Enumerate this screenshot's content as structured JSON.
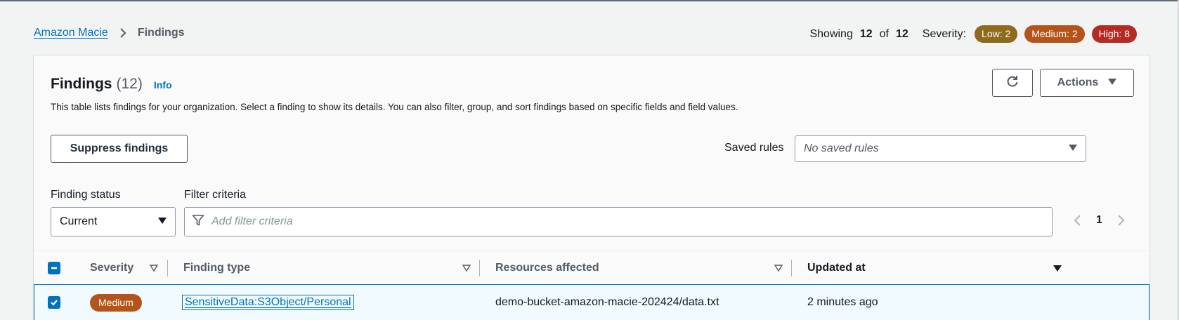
{
  "breadcrumb": {
    "root": "Amazon Macie",
    "current": "Findings"
  },
  "summary": {
    "showing_label": "Showing",
    "showing_count": "12",
    "of_label": "of",
    "total_count": "12",
    "severity_label": "Severity:",
    "low": "Low: 2",
    "medium": "Medium: 2",
    "high": "High: 8"
  },
  "panel": {
    "title": "Findings",
    "count": "(12)",
    "info": "Info",
    "description": "This table lists findings for your organization. Select a finding to show its details. You can also filter, group, and sort findings based on specific fields and field values.",
    "actions_label": "Actions",
    "suppress_label": "Suppress findings",
    "saved_rules_label": "Saved rules",
    "saved_rules_value": "No saved rules",
    "finding_status_label": "Finding status",
    "finding_status_value": "Current",
    "filter_criteria_label": "Filter criteria",
    "filter_placeholder": "Add filter criteria",
    "page": "1"
  },
  "table": {
    "columns": [
      "Severity",
      "Finding type",
      "Resources affected",
      "Updated at"
    ],
    "rows": [
      {
        "severity": "Medium",
        "finding_type": "SensitiveData:S3Object/Personal",
        "resource": "demo-bucket-amazon-macie-202424/data.txt",
        "updated": "2 minutes ago",
        "selected": true
      }
    ]
  },
  "colors": {
    "link": "#0073bb",
    "low": "#8d6a1c",
    "medium": "#b4541a",
    "high": "#b32b21",
    "selected_row_bg": "#f1faff"
  }
}
